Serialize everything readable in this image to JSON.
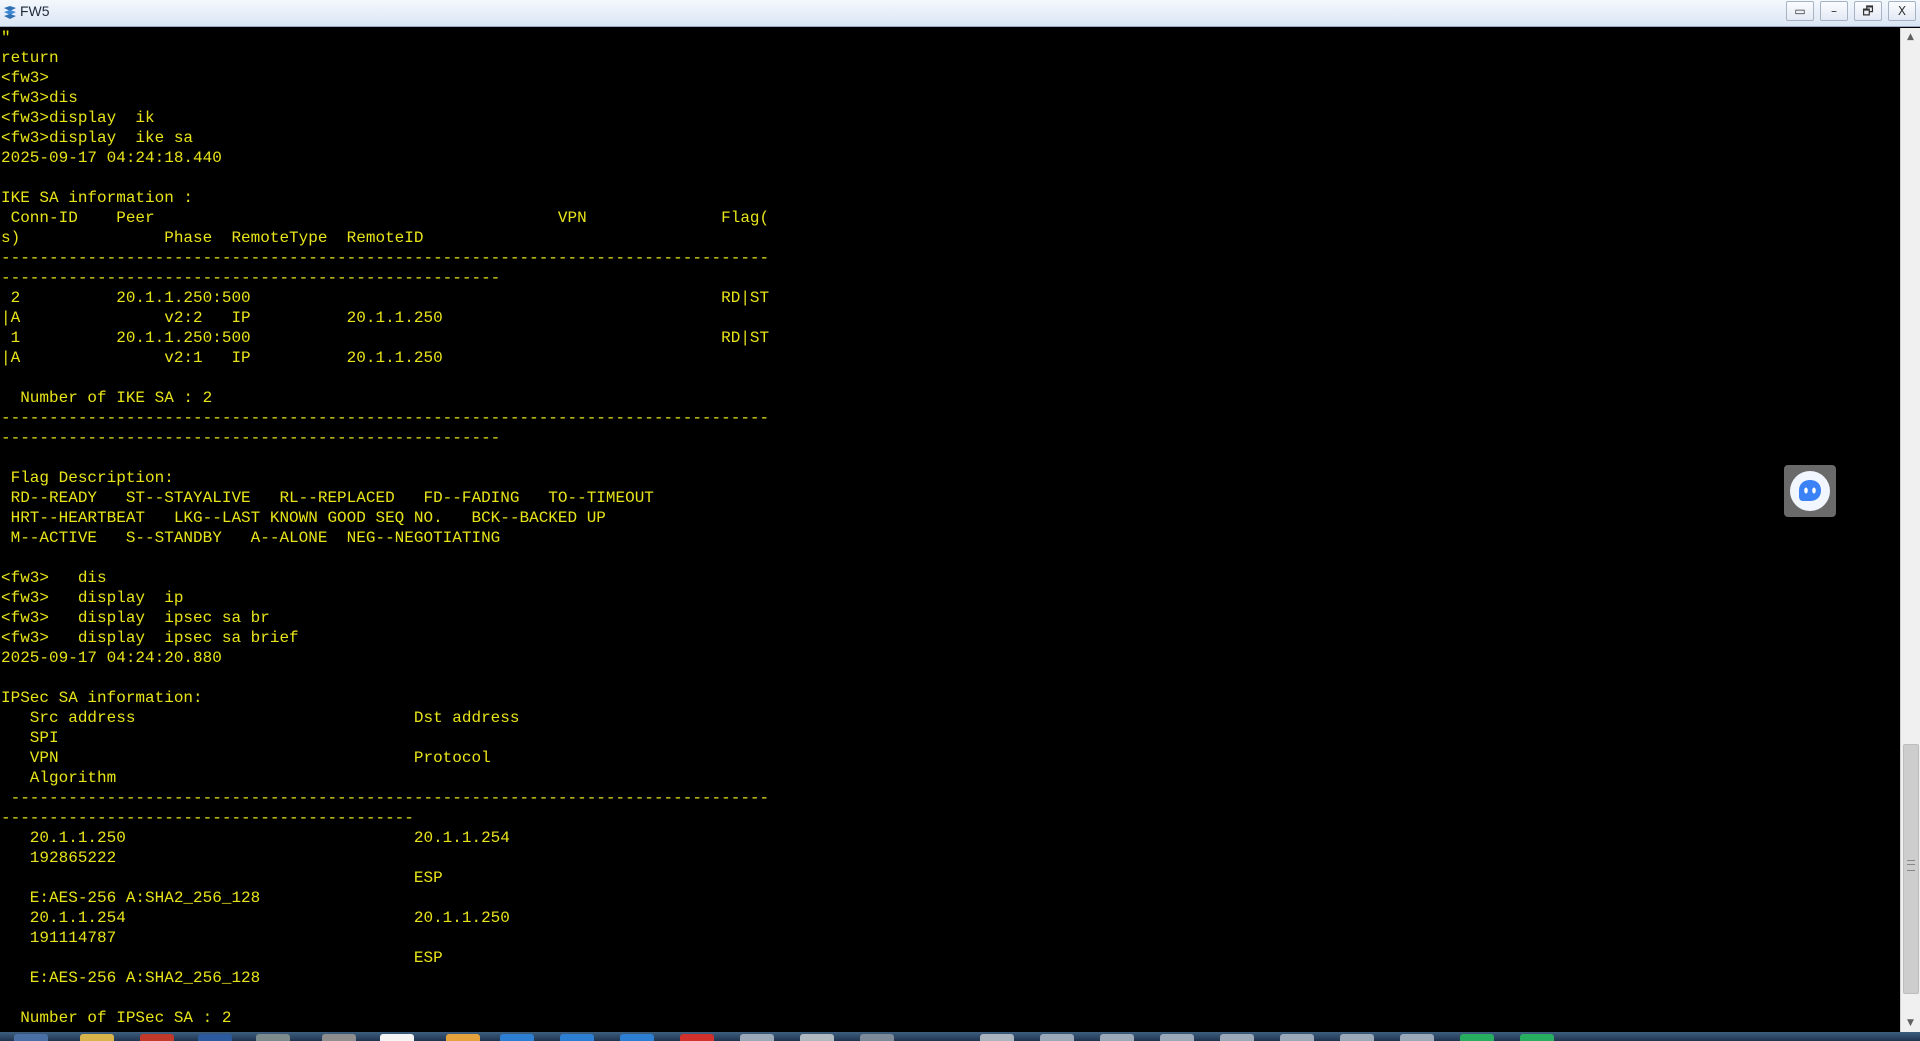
{
  "window": {
    "title": "FW5",
    "buttons": {
      "extra": "▭",
      "minimize": "–",
      "restore": "🗗",
      "close": "X"
    }
  },
  "terminal": {
    "text_color": "#e8e41a",
    "background": "#000000",
    "lines": [
      "\"",
      "return",
      "<fw3>",
      "<fw3>dis",
      "<fw3>display  ik",
      "<fw3>display  ike sa",
      "2025-09-17 04:24:18.440",
      "",
      "IKE SA information :",
      " Conn-ID    Peer                                          VPN              Flag(",
      "s)               Phase  RemoteType  RemoteID",
      "--------------------------------------------------------------------------------",
      "----------------------------------------------------",
      " 2          20.1.1.250:500                                                 RD|ST",
      "|A               v2:2   IP          20.1.1.250",
      " 1          20.1.1.250:500                                                 RD|ST",
      "|A               v2:1   IP          20.1.1.250",
      "",
      "  Number of IKE SA : 2",
      "--------------------------------------------------------------------------------",
      "----------------------------------------------------",
      "",
      " Flag Description:",
      " RD--READY   ST--STAYALIVE   RL--REPLACED   FD--FADING   TO--TIMEOUT",
      " HRT--HEARTBEAT   LKG--LAST KNOWN GOOD SEQ NO.   BCK--BACKED UP",
      " M--ACTIVE   S--STANDBY   A--ALONE  NEG--NEGOTIATING",
      "",
      "<fw3>   dis",
      "<fw3>   display  ip",
      "<fw3>   display  ipsec sa br",
      "<fw3>   display  ipsec sa brief",
      "2025-09-17 04:24:20.880",
      "",
      "IPSec SA information:",
      "   Src address                             Dst address",
      "   SPI",
      "   VPN                                     Protocol",
      "   Algorithm",
      " -------------------------------------------------------------------------------",
      "-------------------------------------------",
      "   20.1.1.250                              20.1.1.254",
      "   192865222",
      "                                           ESP",
      "   E:AES-256 A:SHA2_256_128",
      "   20.1.1.254                              20.1.1.250",
      "   191114787",
      "                                           ESP",
      "   E:AES-256 A:SHA2_256_128",
      "",
      "  Number of IPSec SA : 2",
      " -------------------------------------------------------------------------------"
    ]
  },
  "scrollbar": {
    "up_icon": "up-arrow",
    "down_icon": "down-arrow",
    "position": 0.97
  },
  "taskbar": {
    "item_colors": [
      "#4a6fa5",
      "#d9b44a",
      "#c0392b",
      "#2c5aa0",
      "#7f8c8d",
      "#8e8e8e",
      "#f5f5f5",
      "#e6a23c",
      "#2d7fd3",
      "#2d7fd3",
      "#2d7fd3",
      "#d0312d",
      "#9aa8b8",
      "#b0b8c0",
      "#7c8a99",
      "#aab4bf",
      "#9aa8b8",
      "#9aa8b8",
      "#9aa8b8",
      "#9aa8b8",
      "#9aa8b8",
      "#9aa8b8",
      "#9aa8b8",
      "#27ae60",
      "#27ae60"
    ]
  }
}
